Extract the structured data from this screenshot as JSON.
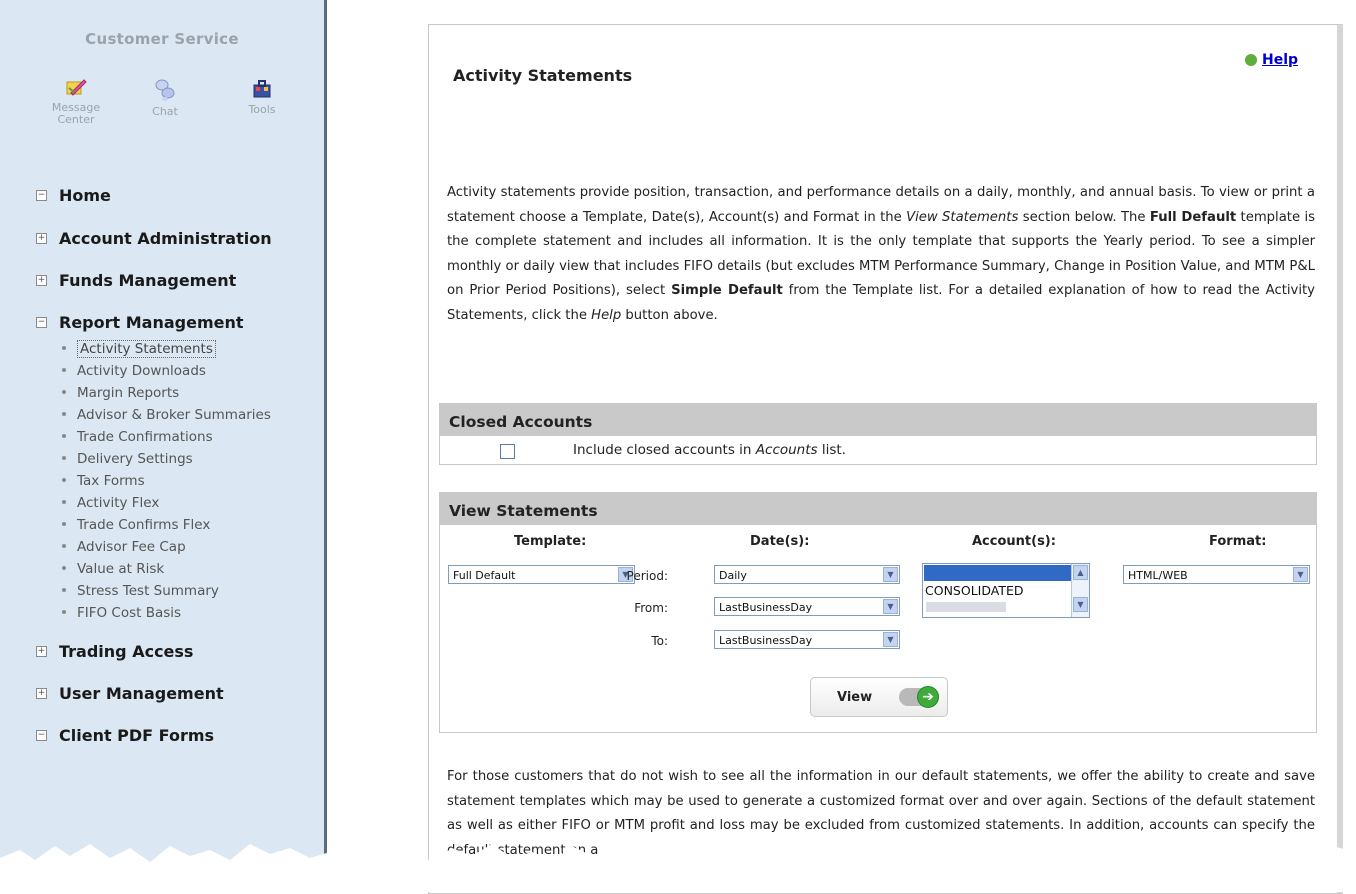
{
  "customer_service": {
    "title": "Customer Service",
    "items": [
      {
        "label_line1": "Message",
        "label_line2": "Center",
        "icon": "pencil-note-icon"
      },
      {
        "label": "Chat",
        "icon": "chat-bubbles-icon"
      },
      {
        "label": "Tools",
        "icon": "toolbox-icon"
      }
    ]
  },
  "nav": {
    "sections": [
      {
        "label": "Home",
        "toggle": "−"
      },
      {
        "label": "Account Administration",
        "toggle": "+"
      },
      {
        "label": "Funds Management",
        "toggle": "+"
      },
      {
        "label": "Report Management",
        "toggle": "−"
      },
      {
        "label": "Trading Access",
        "toggle": "+"
      },
      {
        "label": "User Management",
        "toggle": "+"
      },
      {
        "label": "Client PDF Forms",
        "toggle": "−"
      }
    ],
    "report_items": [
      "Activity Statements",
      "Activity Downloads",
      "Margin Reports",
      "Advisor & Broker Summaries",
      "Trade Confirmations",
      "Delivery Settings",
      "Tax Forms",
      "Activity Flex",
      "Trade Confirms Flex",
      "Advisor Fee Cap",
      "Value at Risk",
      "Stress Test Summary",
      "FIFO Cost Basis"
    ],
    "active_item": "Activity Statements"
  },
  "page": {
    "title": "Activity Statements",
    "help_label": "Help",
    "intro": {
      "p1": "Activity statements provide position, transaction, and performance details on a daily, monthly, and annual basis. To view or print a statement choose a Template, Date(s), Account(s) and Format in the ",
      "p1_em": "View Statements",
      "p2": " section below. The ",
      "p2_b": "Full Default",
      "p3": " template is the complete statement and includes all information. It is the only template that supports the Yearly period. To see a simpler monthly or daily view that includes FIFO details (but excludes MTM Performance Summary, Change in Position Value, and MTM P&L on Prior Period Positions), select ",
      "p3_b": "Simple Default",
      "p4": " from the Template list. For a detailed explanation of how to read the Activity Statements, click the ",
      "p4_em": "Help",
      "p5": " button above."
    },
    "outro": "For those customers that do not wish to see all the information in our default statements, we offer the ability to create and save statement templates which may be used to generate a customized format over and over again. Sections of the default statement as well as either FIFO or MTM profit and loss may be excluded from customized statements. In addition, accounts can specify the default statement on a"
  },
  "closed_accounts": {
    "header": "Closed Accounts",
    "label_pre": "Include closed accounts in ",
    "label_em": "Accounts",
    "label_post": " list.",
    "checked": false
  },
  "view_statements": {
    "header": "View Statements",
    "template": {
      "label": "Template:",
      "value": "Full Default"
    },
    "dates": {
      "label": "Date(s):",
      "period_label": "Period:",
      "period_value": "Daily",
      "from_label": "From:",
      "from_value": "LastBusinessDay",
      "to_label": "To:",
      "to_value": "LastBusinessDay"
    },
    "accounts": {
      "label": "Account(s):",
      "options": [
        "CONSOLIDATED"
      ]
    },
    "format": {
      "label": "Format:",
      "value": "HTML/WEB"
    },
    "view_button": "View"
  },
  "colors": {
    "sidebar_bg": "#dbe7f2",
    "section_header_bg": "#c9c9c9",
    "help_link": "#0000cc",
    "go_green": "#3eab3a",
    "selection_blue": "#316ac5"
  }
}
